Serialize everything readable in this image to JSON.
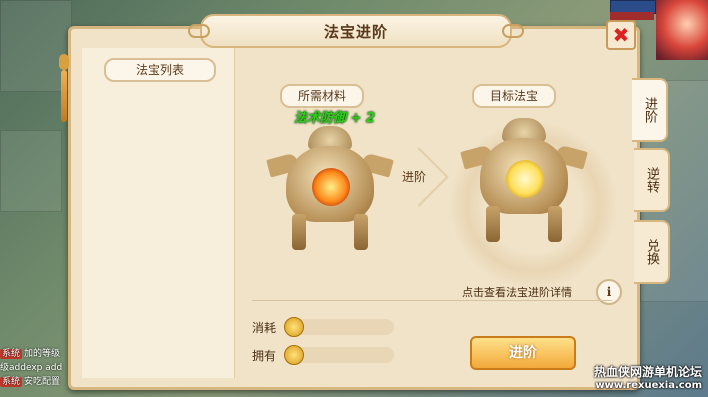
{
  "window": {
    "title": "法宝进阶"
  },
  "left": {
    "list_title": "法宝列表"
  },
  "materials": {
    "label": "所需材料",
    "item_name": "法术防御 + 2"
  },
  "target": {
    "label": "目标法宝"
  },
  "arrow_label": "进阶",
  "detail_link": "点击查看法宝进阶详情",
  "info_icon": "i",
  "resources": {
    "consume_label": "消耗",
    "own_label": "拥有"
  },
  "advance_button": "进阶",
  "tabs": [
    {
      "label": "进阶"
    },
    {
      "label": "逆转"
    },
    {
      "label": "兑换"
    }
  ],
  "chat": [
    {
      "tag": "系统",
      "text": "加的等级"
    },
    {
      "tag": "",
      "text": "级addexp add"
    },
    {
      "tag": "系统",
      "text": "安吃配置"
    }
  ],
  "watermark": {
    "line1": "热血侠网游单机论坛",
    "line2": "www.rexuexia.com"
  },
  "colors": {
    "accent": "#f3a93a",
    "panel": "#f1e3c8",
    "green_text": "#2fcc1a"
  }
}
